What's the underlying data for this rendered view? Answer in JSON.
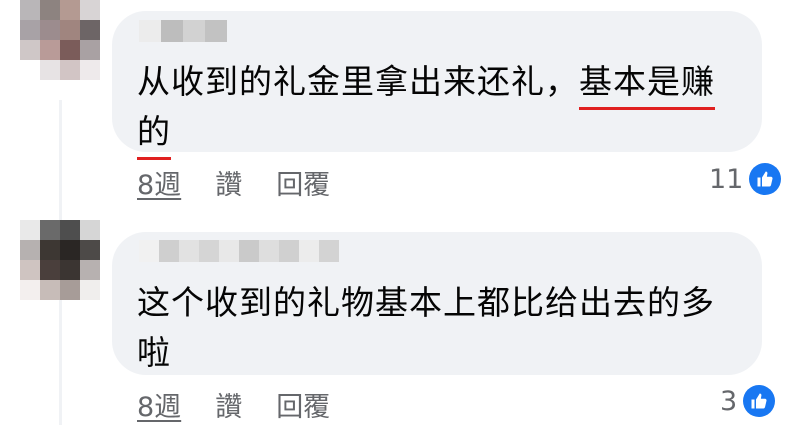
{
  "comments": [
    {
      "text_before": "从收到的礼金里拿出来还礼，",
      "text_highlight_1": "基本是赚",
      "text_highlight_2": "的",
      "time": "8週",
      "like_label": "讚",
      "reply_label": "回覆",
      "reaction_count": "11"
    },
    {
      "text_line_1": "这个收到的礼物基本上都比给出去的多",
      "text_line_2": "啦",
      "time": "8週",
      "like_label": "讚",
      "reply_label": "回覆",
      "reaction_count": "3"
    }
  ],
  "colors": {
    "bubble": "#f0f2f5",
    "highlight_underline": "#e02020",
    "like_blue": "#1877f2",
    "meta_text": "#65676b"
  },
  "icons": {
    "reaction": "like-thumbs-up-icon"
  }
}
